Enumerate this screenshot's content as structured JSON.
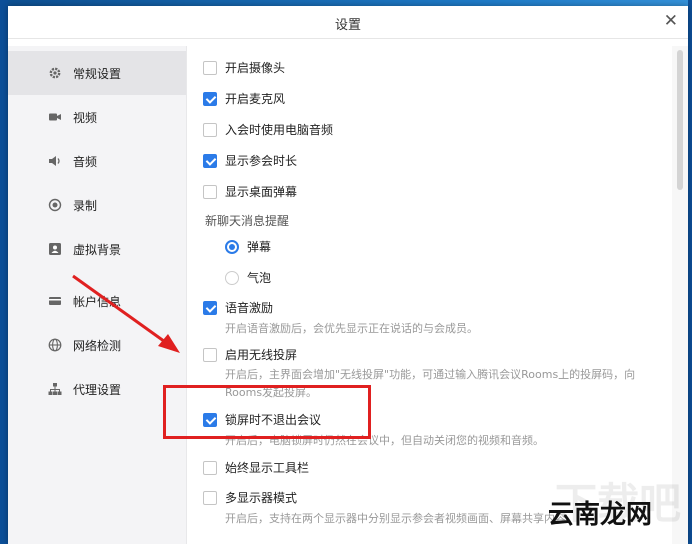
{
  "window": {
    "title": "设置",
    "close_label": "✕"
  },
  "sidebar": {
    "items": [
      {
        "label": "常规设置",
        "icon": "gear-icon",
        "active": true
      },
      {
        "label": "视频",
        "icon": "video-camera-icon"
      },
      {
        "label": "音频",
        "icon": "speaker-icon"
      },
      {
        "label": "录制",
        "icon": "record-icon"
      },
      {
        "label": "虚拟背景",
        "icon": "portrait-icon"
      },
      {
        "label": "帐户信息",
        "icon": "card-icon"
      },
      {
        "label": "网络检测",
        "icon": "globe-icon"
      },
      {
        "label": "代理设置",
        "icon": "network-tree-icon"
      }
    ]
  },
  "settings": {
    "camera": {
      "label": "开启摄像头",
      "checked": false
    },
    "mic": {
      "label": "开启麦克风",
      "checked": true
    },
    "pc_audio": {
      "label": "入会时使用电脑音频",
      "checked": false
    },
    "duration": {
      "label": "显示参会时长",
      "checked": true
    },
    "desktop_popup": {
      "label": "显示桌面弹幕",
      "checked": false
    },
    "chat_section": "新聊天消息提醒",
    "chat_option_1": {
      "label": "弹幕",
      "selected": true
    },
    "chat_option_2": {
      "label": "气泡",
      "selected": false
    },
    "voice_motivate": {
      "label": "语音激励",
      "checked": true,
      "desc": "开启语音激励后，会优先显示正在说话的与会成员。"
    },
    "wireless": {
      "label": "启用无线投屏",
      "checked": false,
      "desc": "开启后，主界面会增加\"无线投屏\"功能，可通过输入腾讯会议Rooms上的投屏码，向Rooms发起投屏。"
    },
    "lock_screen": {
      "label": "锁屏时不退出会议",
      "checked": true,
      "desc": "开启后，电脑锁屏时仍然在会议中，但自动关闭您的视频和音频。"
    },
    "toolbar": {
      "label": "始终显示工具栏",
      "checked": false
    },
    "multi_display": {
      "label": "多显示器模式",
      "checked": false,
      "desc": "开启后，支持在两个显示器中分别显示参会者视频画面、屏幕共享内容。"
    }
  },
  "watermark": {
    "text": "云南龙网",
    "shadow": "下载吧"
  },
  "colors": {
    "accent": "#2b7be8",
    "highlight": "#e02020"
  }
}
